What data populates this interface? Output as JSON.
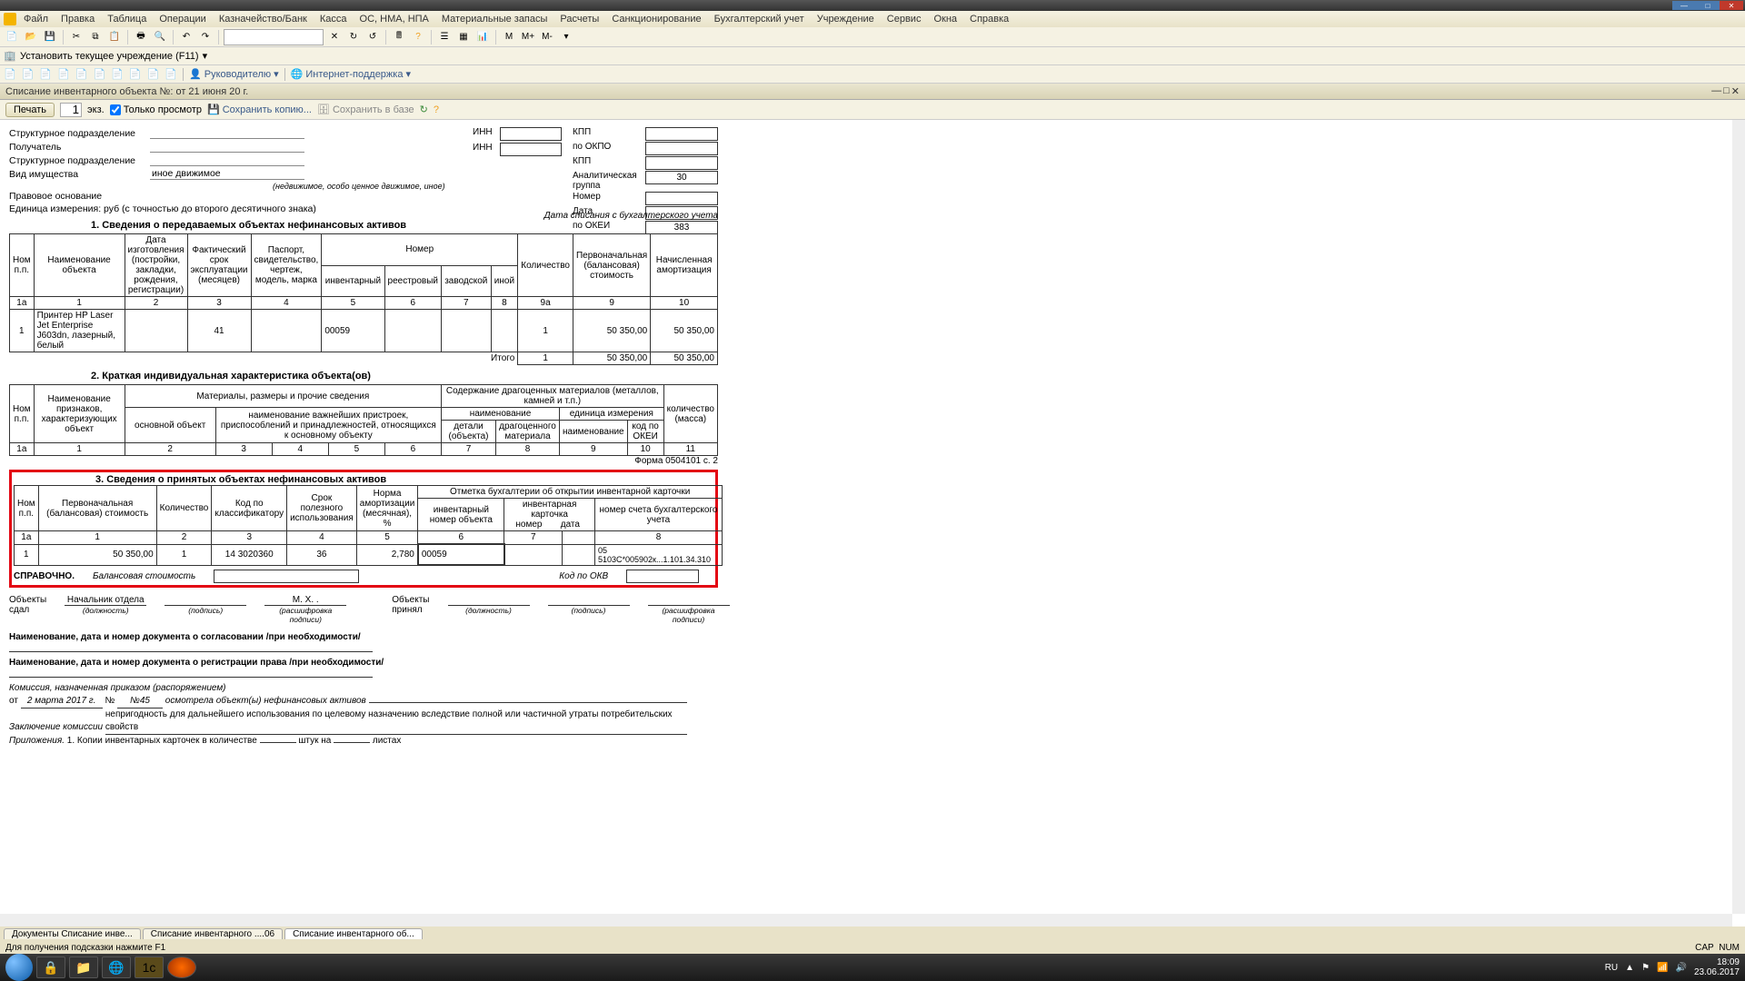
{
  "window": {
    "min": "—",
    "max": "□",
    "close": "✕"
  },
  "menu": {
    "file": "Файл",
    "edit": "Правка",
    "table": "Таблица",
    "ops": "Операции",
    "treasury": "Казначейство/Банк",
    "kassa": "Касса",
    "os": "ОС, НМА, НПА",
    "mat": "Материальные запасы",
    "calc": "Расчеты",
    "sank": "Санкционирование",
    "buh": "Бухгалтерский учет",
    "uchr": "Учреждение",
    "service": "Сервис",
    "windows": "Окна",
    "help": "Справка"
  },
  "tb": {
    "mplus": "M+",
    "mminus": "M-",
    "m": "M"
  },
  "tb2": {
    "set_org": "Установить текущее учреждение (F11)"
  },
  "tb3": {
    "ruk": "Руководителю",
    "inet": "Интернет-поддержка"
  },
  "doc_tab": "Списание инвентарного объекта №:         от 21 июня 20    г.",
  "doc_toolbar": {
    "print": "Печать",
    "copies": "1",
    "ekz": "экз.",
    "view_only": "Только просмотр",
    "save_copy": "Сохранить копию...",
    "save_db": "Сохранить в базе"
  },
  "form": {
    "struct": "Структурное подразделение",
    "recipient": "Получатель",
    "struct2": "Структурное подразделение",
    "prop_type": "Вид имущества",
    "prop_type_val": "иное движимое",
    "prop_note": "(недвижимое, особо ценное движимое, иное)",
    "legal": "Правовое основание",
    "unit": "Единица измерения: руб (с точностью до второго десятичного знака)",
    "inn": "ИНН",
    "kpp": "КПП",
    "okpo": "по ОКПО",
    "anal": "Аналитическая группа",
    "anal_val": "30",
    "nomer": "Номер",
    "date": "Дата",
    "okei": "по ОКЕИ",
    "okei_val": "383",
    "date_note": "Дата списания с бухгалтерского учета"
  },
  "section1": {
    "title": "1. Сведения о передаваемых объектах нефинансовых активов",
    "h": {
      "npp": "Ном п.п.",
      "name": "Наименование объекта",
      "date": "Дата изготовления (постройки, закладки, рождения, регистрации)",
      "srok": "Фактический срок эксплуатации (месяцев)",
      "passport": "Паспорт, свидетельство, чертеж, модель, марка",
      "nomer": "Номер",
      "inv": "инвентарный",
      "reestr": "реестровый",
      "zavod": "заводской",
      "inoy": "иной",
      "qty": "Количество",
      "cost": "Первоначальная (балансовая) стоимость",
      "amort": "Начисленная амортизация"
    },
    "cols": [
      "1а",
      "1",
      "2",
      "3",
      "4",
      "5",
      "6",
      "7",
      "8",
      "9а",
      "9",
      "10"
    ],
    "row": {
      "n": "1",
      "name": "Принтер HP Laser Jet Enterprise      J603dn, лазерный, белый",
      "srok": "41",
      "inv": "00059",
      "qty": "1",
      "cost": "50 350,00",
      "amort": "50 350,00"
    },
    "total": "Итого",
    "t_qty": "1",
    "t_cost": "50 350,00",
    "t_amort": "50 350,00"
  },
  "section2": {
    "title": "2. Краткая индивидуальная характеристика объекта(ов)",
    "h": {
      "npp": "Ном п.п.",
      "name": "Наименование признаков, характеризующих объект",
      "mat": "Материалы, размеры и прочие сведения",
      "main": "основной объект",
      "attach": "наименование важнейших пристроек, приспособлений и принадлежностей, относящихся к основному объекту",
      "prec": "Содержание драгоценных материалов (металлов, камней и т.п.)",
      "naim": "наименование",
      "ed": "единица измерения",
      "detail": "детали (объекта)",
      "dragmat": "драгоценного материала",
      "naim2": "наименование",
      "okei": "код по ОКЕИ",
      "qty": "количество (масса)"
    },
    "cols": [
      "1а",
      "1",
      "2",
      "3",
      "4",
      "5",
      "6",
      "7",
      "8",
      "9",
      "10",
      "11"
    ],
    "form_note": "Форма 0504101 с. 2"
  },
  "section3": {
    "title": "3. Сведения о принятых объектах нефинансовых активов",
    "h": {
      "npp": "Ном п.п.",
      "cost": "Первоначальная (балансовая) стоимость",
      "qty": "Количество",
      "code": "Код по классификатору",
      "srok": "Срок полезного использования",
      "norma": "Норма амортизации (месячная), %",
      "mark": "Отметка бухгалтерии об открытии инвентарной карточки",
      "inv": "инвентарный номер объекта",
      "card": "инвентарная карточка",
      "cnum": "номер",
      "cdate": "дата",
      "acct": "номер счета бухгалтерского учета"
    },
    "cols": [
      "1а",
      "1",
      "2",
      "3",
      "4",
      "5",
      "6",
      "7",
      "8"
    ],
    "row": {
      "n": "1",
      "cost": "50 350,00",
      "qty": "1",
      "code": "14 3020360",
      "srok": "36",
      "norma": "2,780",
      "inv": "00059",
      "acct": "05  5103С*005902к...1.101.34.310"
    },
    "sprav": "СПРАВОЧНО.",
    "bal": "Балансовая стоимость",
    "okv": "Код по ОКВ"
  },
  "sign": {
    "sdal": "Объекты сдал",
    "sdal_pos": "Начальник отдела",
    "sdal_name": "М. Х.    .",
    "prin": "Объекты принял",
    "pos": "(должность)",
    "sig": "(подпись)",
    "dec": "(расшифровка подписи)"
  },
  "footer": {
    "l1": "Наименование, дата и номер документа о согласовании /при необходимости/",
    "l2": "Наименование, дата и номер документа о регистрации права /при необходимости/",
    "l3": "Комиссия, назначенная приказом (распоряжением)",
    "l4a": "от",
    "l4b": "2 марта 2017 г.",
    "l4c": "№",
    "l4d": "№45",
    "l4e": "осмотрела объект(ы) нефинансовых активов",
    "l5": "Заключение комиссии",
    "l5v": "непригодность для дальнейшего использования по целевому назначению вследствие полной или частичной утраты потребительских свойств",
    "l6": "Приложения.",
    "l6v": "1. Копии инвентарных карточек в количестве",
    "l6s": "штук на",
    "l6p": "листах"
  },
  "tabs": {
    "t1": "Документы Списание инве...",
    "t2": "Списание инвентарного ....06",
    "t3": "Списание инвентарного об..."
  },
  "status": {
    "hint": "Для получения подсказки нажмите F1",
    "cap": "CAP",
    "num": "NUM"
  },
  "tray": {
    "lang": "RU",
    "time": "18:09",
    "date": "23.06.2017"
  }
}
